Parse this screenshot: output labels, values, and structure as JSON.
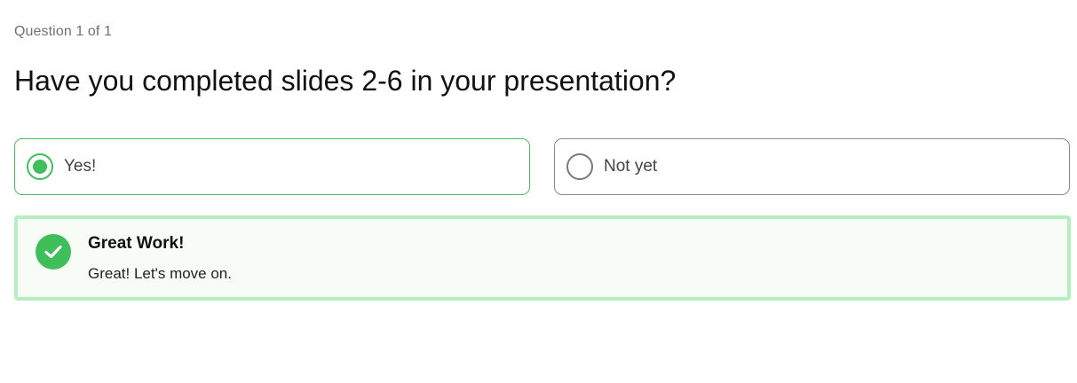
{
  "quiz": {
    "counter": "Question 1 of 1",
    "question": "Have you completed slides 2-6 in your presentation?",
    "options": [
      {
        "label": "Yes!",
        "selected": true
      },
      {
        "label": "Not yet",
        "selected": false
      }
    ]
  },
  "feedback": {
    "icon": "check-circle-icon",
    "title": "Great Work!",
    "message": "Great! Let's move on."
  },
  "colors": {
    "accent_green": "#3fbe5a",
    "feedback_border": "#b6efbf",
    "feedback_bg": "#f7fcf7"
  }
}
